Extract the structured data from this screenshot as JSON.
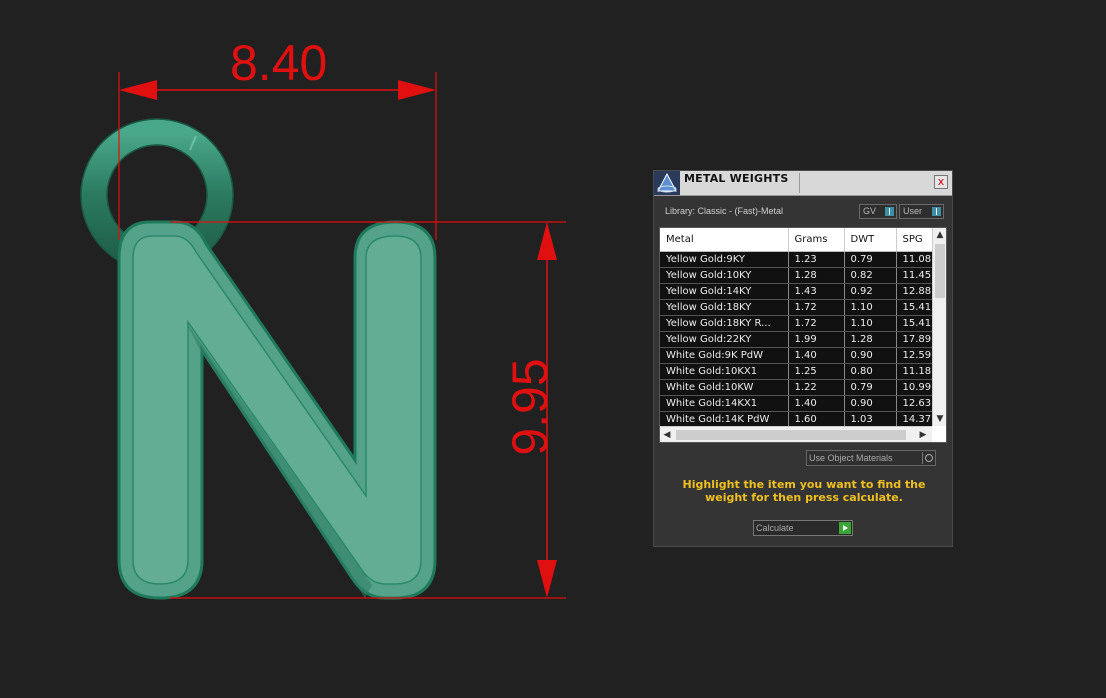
{
  "dimensions": {
    "width": "8.40",
    "height": "9.95"
  },
  "panel": {
    "title": "METAL WEIGHTS",
    "close_label": "x",
    "library_label": "Library: Classic - (Fast)-Metal",
    "gv_label": "GV",
    "user_label": "User",
    "columns": [
      "Metal",
      "Grams",
      "DWT",
      "SPG"
    ],
    "rows": [
      [
        "Yellow Gold:9KY",
        "1.23",
        "0.79",
        "11.08"
      ],
      [
        "Yellow Gold:10KY",
        "1.28",
        "0.82",
        "11.45"
      ],
      [
        "Yellow Gold:14KY",
        "1.43",
        "0.92",
        "12.88"
      ],
      [
        "Yellow Gold:18KY",
        "1.72",
        "1.10",
        "15.41"
      ],
      [
        "Yellow Gold:18KY R...",
        "1.72",
        "1.10",
        "15.41"
      ],
      [
        "Yellow Gold:22KY",
        "1.99",
        "1.28",
        "17.89"
      ],
      [
        "White Gold:9K PdW",
        "1.40",
        "0.90",
        "12.59"
      ],
      [
        "White Gold:10KX1",
        "1.25",
        "0.80",
        "11.18"
      ],
      [
        "White Gold:10KW",
        "1.22",
        "0.79",
        "10.99"
      ],
      [
        "White Gold:14KX1",
        "1.40",
        "0.90",
        "12.63"
      ],
      [
        "White Gold:14K PdW",
        "1.60",
        "1.03",
        "14.37"
      ]
    ],
    "use_object_materials": "Use Object Materials",
    "hint": "Highlight the item you want to find the weight for then press calculate.",
    "calculate_label": "Calculate"
  },
  "colors": {
    "background": "#212121",
    "dimension_red": "#e01010",
    "model_green": "#3e9a7c",
    "hint_yellow": "#f0c020"
  }
}
